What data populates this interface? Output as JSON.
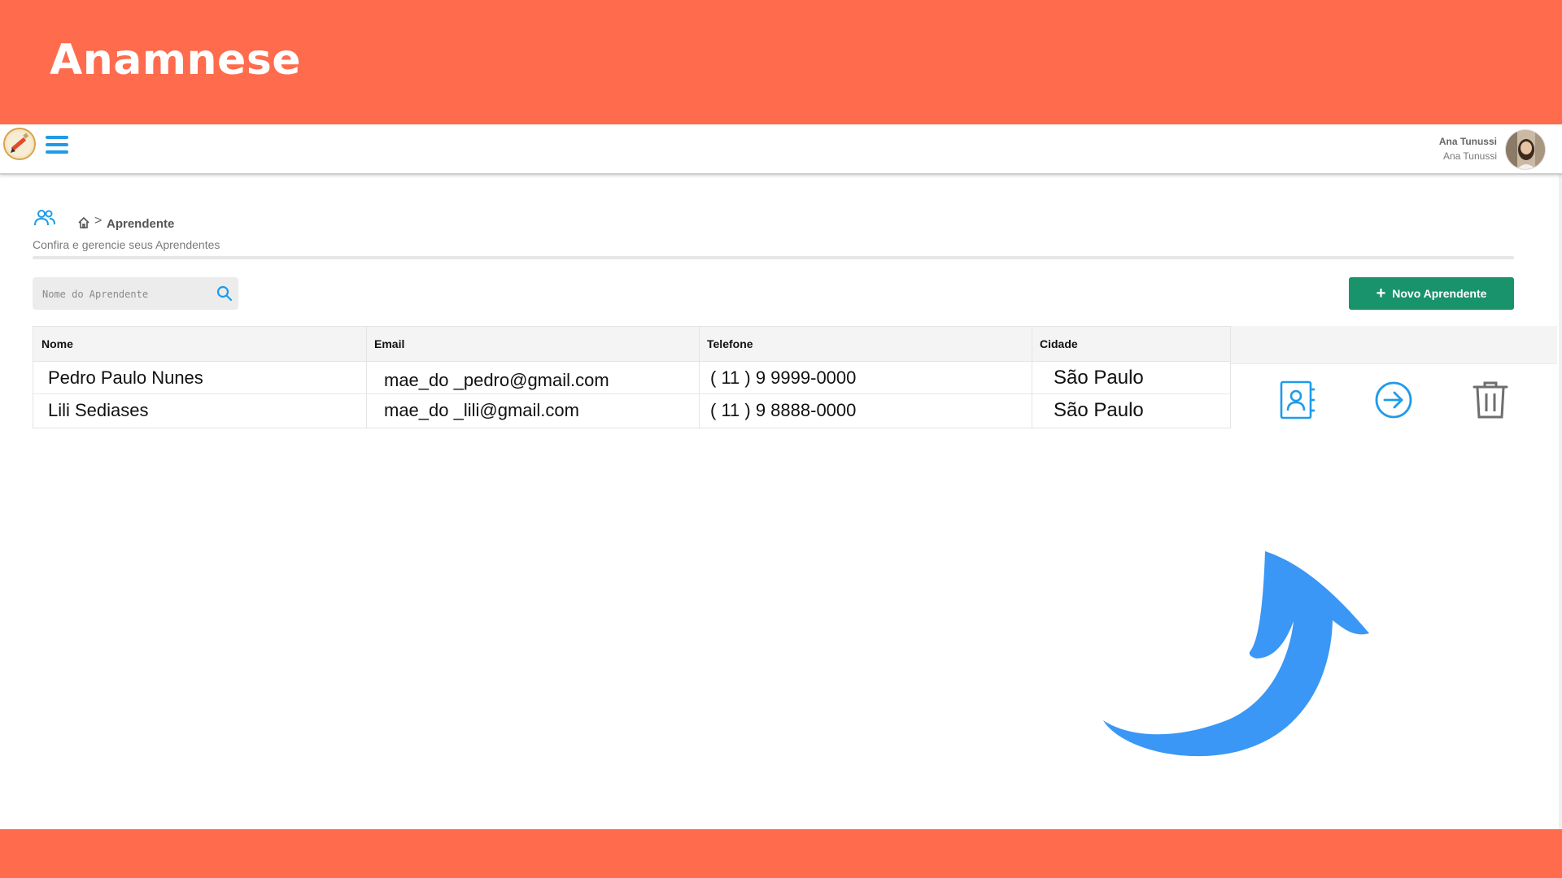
{
  "banner": {
    "title": "Anamnese"
  },
  "user": {
    "name": "Ana Tunussi",
    "subtitle": "Ana Tunussi"
  },
  "breadcrumb": {
    "current": "Aprendente",
    "separator": ">"
  },
  "page": {
    "subtitle": "Confira e gerencie seus Aprendentes"
  },
  "search": {
    "placeholder": "Nome do Aprendente",
    "value": ""
  },
  "actions": {
    "new_label": "Novo Aprendente"
  },
  "table": {
    "headers": [
      "Nome",
      "Email",
      "Telefone",
      "Cidade"
    ],
    "rows": [
      [
        "Pedro Paulo Nunes",
        "mae_do _pedro@gmail.com",
        "( 11 ) 9 9999-0000",
        "São Paulo"
      ],
      [
        "Lili Sediases",
        "mae_do _lili@gmail.com",
        "( 11 ) 9 8888-0000",
        "São Paulo"
      ]
    ]
  },
  "colors": {
    "banner": "#ff6b4d",
    "accent_blue": "#1e9be9",
    "primary_green": "#18936b",
    "arrow_blue": "#3a97f5"
  },
  "icons": {
    "logo": "pencil-logo",
    "menu": "hamburger-menu-icon",
    "page": "users-icon",
    "home": "home-icon",
    "search": "search-icon",
    "new": "plus-icon",
    "row_actions": [
      "contact-card-icon",
      "arrow-right-circle-icon",
      "trash-icon"
    ]
  }
}
